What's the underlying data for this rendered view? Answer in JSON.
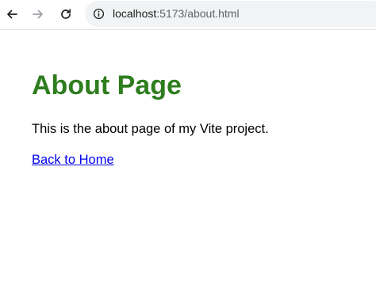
{
  "browser": {
    "back_icon": "arrow-left-icon",
    "forward_icon": "arrow-right-icon",
    "reload_icon": "reload-icon",
    "site_info_icon": "info-circle-icon",
    "url_host": "localhost",
    "url_path": ":5173/about.html"
  },
  "page": {
    "heading": "About Page",
    "heading_color": "#2e7d1e",
    "paragraph": "This is the about page of my Vite project.",
    "link_label": "Back to Home",
    "link_color": "#0000ee"
  }
}
